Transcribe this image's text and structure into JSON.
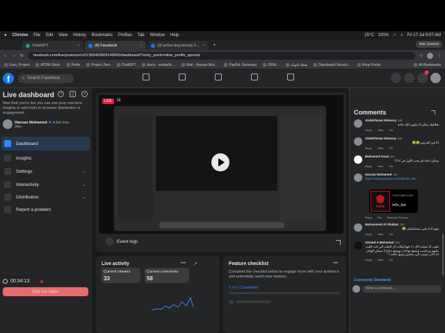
{
  "menubar": {
    "items": [
      "Chrome",
      "File",
      "Edit",
      "View",
      "History",
      "Bookmarks",
      "Profiles",
      "Tab",
      "Window",
      "Help"
    ],
    "temp": "25°C",
    "battery": "100%",
    "datetime": "Fri 17 Jul  9:07 AM"
  },
  "tabs": [
    {
      "label": "ChatGPT",
      "close": "×"
    },
    {
      "label": "(8) Facebook",
      "close": "×"
    },
    {
      "label": "(3) active-bug bounty hunti…",
      "close": "×"
    }
  ],
  "new_tab": "+",
  "gemini_label": "Ask Gemini",
  "url": "facebook.com/live/producer/v2/1395453609149903/dashboard/?entry_point=inline_profile_sprouts",
  "bookmarks": [
    "Guru_Project",
    "ATOM-Stock",
    "Perks",
    "Project Zero",
    "ChatGPT",
    "block - vonkar0r…",
    "Mail - Hassan Mut…",
    "PayPal: Summary",
    "DRM…",
    "نقطة النهاية",
    "Dashboard Securit…",
    "Hoop Portal"
  ],
  "bookmarks_all": "All Bookmarks",
  "fbnav": {
    "logo": "f",
    "search_placeholder": "Search Facebook",
    "notif_count": "7"
  },
  "sidebar": {
    "title": "Live dashboard",
    "description": "Now that you're live you can see your real-time insights or add tools to increase distribution or engagement.",
    "host_name": "Hassan Mohamed",
    "host_status": "is live now.",
    "host_sub": "34m·",
    "items": [
      {
        "label": "Dashboard",
        "chev": ""
      },
      {
        "label": "Insights",
        "chev": ""
      },
      {
        "label": "Settings",
        "chev": "⌄"
      },
      {
        "label": "Interactivity",
        "chev": "⌄"
      },
      {
        "label": "Distribution",
        "chev": "⌄"
      },
      {
        "label": "Report a problem",
        "chev": ""
      }
    ],
    "timer": "00:34:13",
    "end_button": "End live video"
  },
  "video": {
    "live_badge": "LIVE",
    "viewers_badge": "22",
    "event_logs": "Event logs"
  },
  "activity": {
    "title": "Live activity",
    "dots": "•••",
    "viewers_label": "Current viewers",
    "viewers_value": "33",
    "comments_label": "Current comments",
    "comments_value": "58"
  },
  "checklist": {
    "title": "Feature checklist",
    "dots": "•••",
    "description": "Complete the checklist below to engage more with your audience and potentially reach new viewers.",
    "progress": "0 of 5 Completed"
  },
  "comments": {
    "title": "Comments",
    "items": [
      {
        "name": "Abdelrhman Elemery",
        "time": "1m",
        "text": "هتلاقيك متكئ 3 مليون الله جاحه",
        "rtl": true,
        "link": false,
        "acts": [
          "Reply",
          "Hide",
          "Pin"
        ]
      },
      {
        "name": "Abdelrhman Elemery",
        "time": "1m",
        "text": "انا في العربيتي😂😂",
        "rtl": true,
        "link": false,
        "acts": [
          "Reply",
          "Hide",
          "Pin"
        ]
      },
      {
        "name": "Mohamed Anani",
        "time": "1m",
        "text": "ممكن احط اي يحب الاول في CV؟",
        "rtl": true,
        "link": false,
        "acts": [
          "Reply",
          "Hide",
          "Pin"
        ]
      },
      {
        "name": "Hassan Mohamed",
        "time": "1m",
        "text": "https://www.youtube.com/@rs0n_live",
        "rtl": false,
        "link": true,
        "acts": [
          "Reply",
          "Pin",
          "Remove Preview"
        ]
      },
      {
        "name": "Mohammed Al Shaban",
        "time": "1m",
        "text": "مهم 2.2 يعني ممبتشفش 😂",
        "rtl": true,
        "link": false,
        "acts": [
          "Reply",
          "Hide",
          "Pin"
        ]
      },
      {
        "name": "Ahmed A Mohamed",
        "time": "1m",
        "text": "طيب انا عملت لاك ١١ فيها ليكات ال الطب الي انت القت عليهم ورناسب وتيجها بهاجات ووضع دجاج لا ممكن الهاجر انه الاب بسبب الي مختش يفرق حاجه ؟",
        "rtl": true,
        "link": false,
        "acts": [
          "Reply",
          "Hide",
          "Pin"
        ]
      }
    ],
    "yt_domain": "YOUTUBE.COM",
    "yt_name": "rs0n_live",
    "yt_logo": "RS0N",
    "community_standards": "Community Standards",
    "input_placeholder": "Write a comment..."
  }
}
